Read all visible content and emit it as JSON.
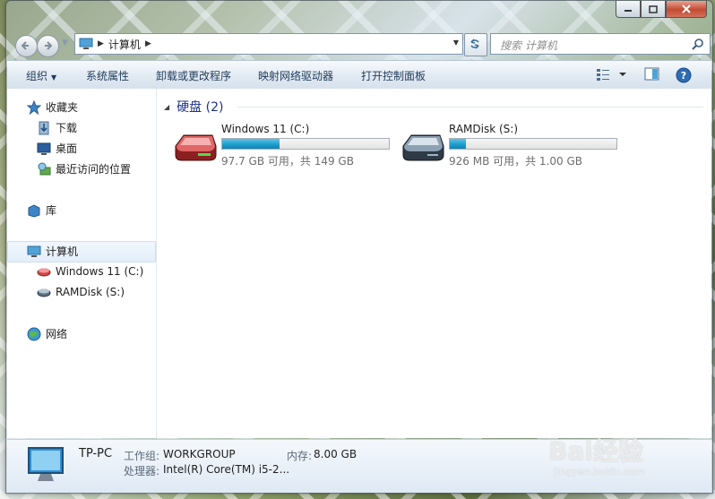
{
  "window": {
    "controls": {
      "minimize": "minimize",
      "maximize": "maximize",
      "close": "close"
    }
  },
  "nav_bar": {
    "breadcrumb": [
      "计算机"
    ],
    "search_placeholder": "搜索 计算机"
  },
  "toolbar": {
    "organize": "组织",
    "system_properties": "系统属性",
    "uninstall": "卸载或更改程序",
    "map_drive": "映射网络驱动器",
    "control_panel": "打开控制面板"
  },
  "sidebar": {
    "favorites": "收藏夹",
    "downloads": "下载",
    "desktop": "桌面",
    "recent": "最近访问的位置",
    "libraries": "库",
    "computer": "计算机",
    "drive_c": "Windows 11 (C:)",
    "drive_s": "RAMDisk (S:)",
    "network": "网络"
  },
  "main": {
    "group_title": "硬盘 (2)",
    "drives": [
      {
        "name": "Windows 11 (C:)",
        "free_text": "97.7 GB 可用，共 149 GB",
        "used_fraction": 0.344,
        "icon": "system-drive-icon"
      },
      {
        "name": "RAMDisk (S:)",
        "free_text": "926 MB 可用，共 1.00 GB",
        "used_fraction": 0.096,
        "icon": "hard-drive-icon"
      }
    ]
  },
  "details": {
    "pc_name": "TP-PC",
    "workgroup_label": "工作组:",
    "workgroup_value": "WORKGROUP",
    "memory_label": "内存:",
    "memory_value": "8.00 GB",
    "cpu_label": "处理器:",
    "cpu_value": "Intel(R) Core(TM) i5-2..."
  },
  "watermark": {
    "logo": "Bai经验",
    "sub": "jingyan.baidu.com"
  },
  "colors": {
    "accent": "#1e3287",
    "progress": "#1d9fd0",
    "close": "#c44a32"
  }
}
